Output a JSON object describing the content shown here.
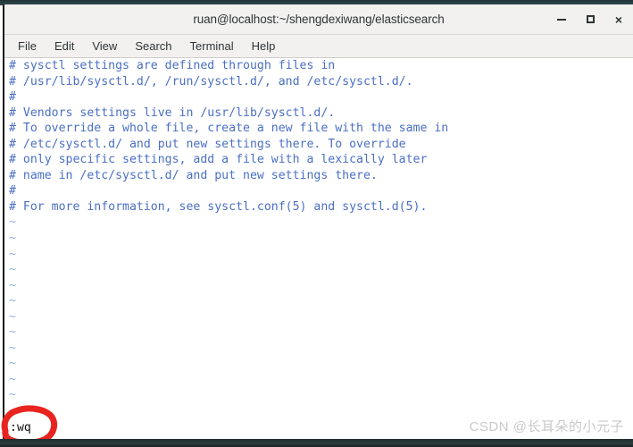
{
  "window": {
    "title": "ruan@localhost:~/shengdexiwang/elasticsearch",
    "controls": {
      "minimize": "minimize",
      "maximize": "maximize",
      "close": "×"
    }
  },
  "menubar": {
    "items": [
      {
        "label": "File"
      },
      {
        "label": "Edit"
      },
      {
        "label": "View"
      },
      {
        "label": "Search"
      },
      {
        "label": "Terminal"
      },
      {
        "label": "Help"
      }
    ]
  },
  "terminal": {
    "editor": "vim",
    "text_color": "#4a6fc4",
    "tilde_color": "#8fb0e3",
    "background_color": "#ffffff",
    "lines": [
      "# sysctl settings are defined through files in",
      "# /usr/lib/sysctl.d/, /run/sysctl.d/, and /etc/sysctl.d/.",
      "#",
      "# Vendors settings live in /usr/lib/sysctl.d/.",
      "# To override a whole file, create a new file with the same in",
      "# /etc/sysctl.d/ and put new settings there. To override",
      "# only specific settings, add a file with a lexically later",
      "# name in /etc/sysctl.d/ and put new settings there.",
      "#",
      "# For more information, see sysctl.conf(5) and sysctl.d(5)."
    ],
    "empty_line_marker": "~",
    "empty_line_count": 13,
    "status_command": ":wq"
  },
  "annotation": {
    "type": "hand-drawn-circle",
    "color": "#e8241f",
    "target": ":wq"
  },
  "watermark": {
    "text": "CSDN @长耳朵的小元子"
  }
}
